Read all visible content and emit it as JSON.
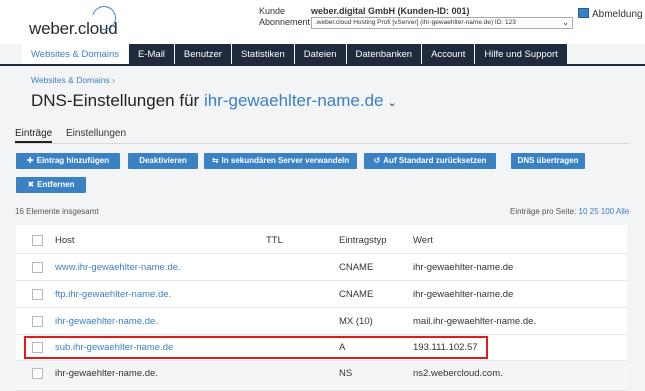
{
  "header": {
    "logo_text": "weber.cloud",
    "kunde_label": "Kunde",
    "kunde_value": "weber.digital GmbH (Kunden-ID: 001)",
    "abo_label": "Abonnement",
    "abo_value": ".weber.cloud Hosting Profi [vServer] (ihr-gewaehlter-name.de) ID: 123",
    "logout_label": "Abmeldung"
  },
  "nav": {
    "tabs": [
      {
        "label": "Websites & Domains"
      },
      {
        "label": "E-Mail"
      },
      {
        "label": "Benutzer"
      },
      {
        "label": "Statistiken"
      },
      {
        "label": "Dateien"
      },
      {
        "label": "Datenbanken"
      },
      {
        "label": "Account"
      },
      {
        "label": "Hilfe und Support"
      }
    ]
  },
  "breadcrumb": "Websites & Domains ›",
  "page_title": {
    "prefix": "DNS-Einstellungen für",
    "domain": "ihr-gewaehlter-name.de"
  },
  "subtabs": [
    "Einträge",
    "Einstellungen"
  ],
  "toolbar": {
    "add": "Eintrag hinzufügen",
    "deactivate": "Deaktivieren",
    "secondary": "In sekundären Server verwandeln",
    "default": "Auf Standard zurücksetzen",
    "transfer": "DNS übertragen",
    "remove": "Entfernen"
  },
  "list": {
    "count": "16 Elemente insgesamt",
    "perpage_label": "Einträge pro Seite:",
    "perpage_options": [
      "10",
      "25",
      "100",
      "Alle"
    ]
  },
  "table": {
    "headers": [
      "Host",
      "TTL",
      "Eintragstyp",
      "Wert"
    ],
    "rows": [
      {
        "host": "www.ihr-gewaehlter-name.de.",
        "ttl": "",
        "type": "CNAME",
        "value": "ihr-gewaehlter-name.de"
      },
      {
        "host": "ftp.ihr-gewaehlter-name.de.",
        "ttl": "",
        "type": "CNAME",
        "value": "ihr-gewaehlter-name.de"
      },
      {
        "host": "ihr-gewaehlter-name.de.",
        "ttl": "",
        "type": "MX (10)",
        "value": "mail.ihr-gewaehlter-name.de."
      },
      {
        "host": "sub.ihr-gewaehlter-name.de",
        "ttl": "",
        "type": "A",
        "value": "193.111.102.57"
      },
      {
        "host": "ihr-gewaehlter-name.de.",
        "ttl": "",
        "type": "NS",
        "value": "ns2.webercloud.com."
      }
    ]
  },
  "colors": {
    "accent": "#3b82c4",
    "nav_bg": "#1f2a3c",
    "highlight": "#e01b1b"
  }
}
